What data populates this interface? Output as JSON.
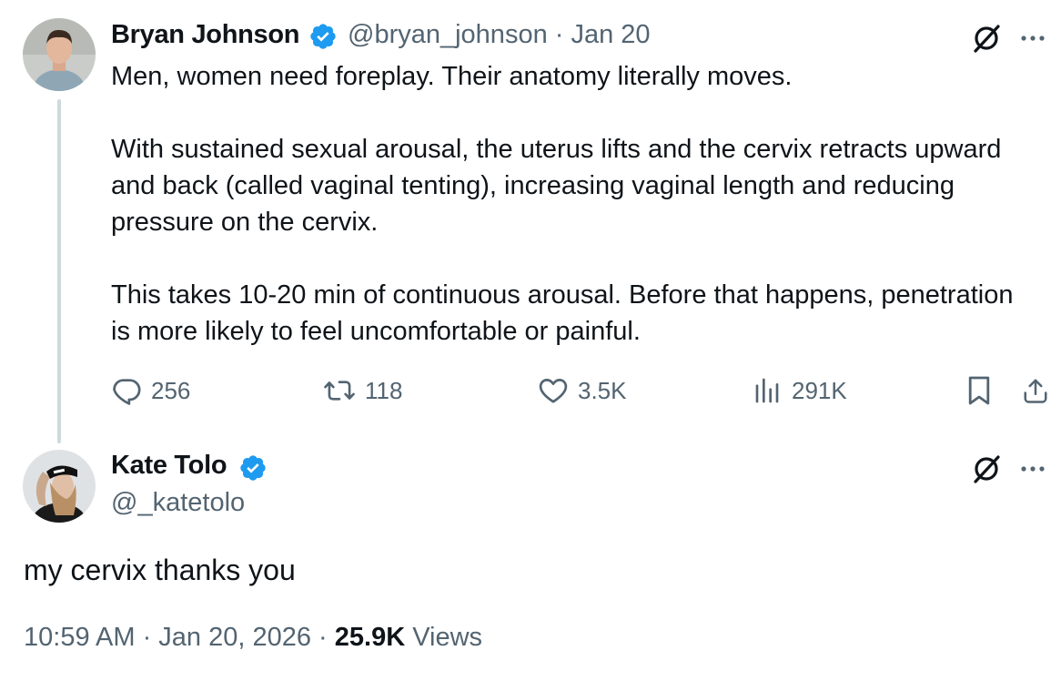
{
  "colors": {
    "text": "#0f1419",
    "secondary": "#536471",
    "verified": "#1d9bf0",
    "thread_line": "#cfd9de"
  },
  "parent_tweet": {
    "author_name": "Bryan Johnson",
    "handle_and_date": "@bryan_johnson · Jan 20",
    "verified_icon": "verified-badge-icon",
    "text": "Men, women need foreplay. Their anatomy literally moves.\n\nWith sustained sexual arousal, the uterus lifts and the cervix retracts upward and back (called vaginal tenting), increasing vaginal length and reducing pressure on the cervix.\n\nThis takes 10-20 min of continuous arousal. Before that happens, penetration is more likely to feel uncomfortable or painful.",
    "actions": {
      "replies": "256",
      "reposts": "118",
      "likes": "3.5K",
      "views": "291K"
    }
  },
  "reply_tweet": {
    "author_name": "Kate Tolo",
    "handle": "@_katetolo",
    "verified_icon": "verified-badge-icon",
    "text": "my cervix thanks you",
    "timestamp": "10:59 AM · Jan 20, 2026 · ",
    "views_count": "25.9K",
    "views_label": " Views"
  }
}
